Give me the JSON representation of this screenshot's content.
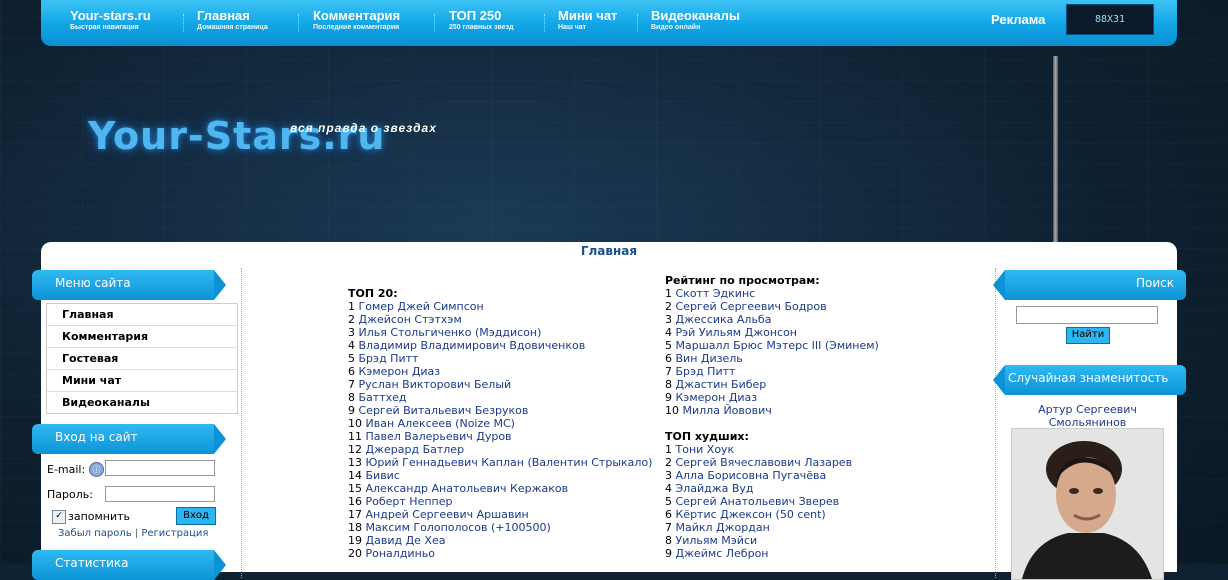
{
  "nav": [
    {
      "title": "Your-stars.ru",
      "sub": "Быстрая навигация"
    },
    {
      "title": "Главная",
      "sub": "Домашняя страница"
    },
    {
      "title": "Комментария",
      "sub": "Последние комментария"
    },
    {
      "title": "ТОП 250",
      "sub": "250 главных звезд"
    },
    {
      "title": "Мини чат",
      "sub": "Наш чат"
    },
    {
      "title": "Видеоканалы",
      "sub": "Видео онлайн"
    }
  ],
  "ads_label": "Реклама",
  "banner_label": "88X31",
  "logo": {
    "main": "Your-Stars.ru",
    "tagline": "вся правда о звездах"
  },
  "breadcrumb": "Главная",
  "site_menu": {
    "title": "Меню сайта",
    "items": [
      "Главная",
      "Комментария",
      "Гостевая",
      "Мини чат",
      "Видеоканалы"
    ]
  },
  "login": {
    "title": "Вход на сайт",
    "email_label": "E-mail:",
    "password_label": "Пароль:",
    "remember_label": "запомнить",
    "submit_label": "Вход",
    "forgot_link": "Забыл пароль",
    "separator": "|",
    "register_link": "Регистрация"
  },
  "stats_title": "Статистика",
  "top20": {
    "heading": "ТОП 20:",
    "items": [
      {
        "n": "1",
        "name": "Гомер Джей Симпсон"
      },
      {
        "n": "2",
        "name": "Джейсон Стэтхэм"
      },
      {
        "n": "3",
        "name": "Илья Стольгиченко (Мэддисон)"
      },
      {
        "n": "4",
        "name": "Владимир Владимирович Вдовиченков"
      },
      {
        "n": "5",
        "name": "Брэд Питт"
      },
      {
        "n": "6",
        "name": "Кэмерон Диаз"
      },
      {
        "n": "7",
        "name": "Руслан Викторович Белый"
      },
      {
        "n": "8",
        "name": "Баттхед"
      },
      {
        "n": "9",
        "name": "Сергей Витальевич Безруков"
      },
      {
        "n": "10",
        "name": "Иван Алексеев (Noize MC)"
      },
      {
        "n": "11",
        "name": "Павел Валерьевич Дуров"
      },
      {
        "n": "12",
        "name": "Джерард Батлер"
      },
      {
        "n": "13",
        "name": "Юрий Геннадьевич Каплан (Валентин Стрыкало)"
      },
      {
        "n": "14",
        "name": "Бивис"
      },
      {
        "n": "15",
        "name": "Александр Анатольевич Кержаков"
      },
      {
        "n": "16",
        "name": "Роберт Неппер"
      },
      {
        "n": "17",
        "name": "Андрей Сергеевич Аршавин"
      },
      {
        "n": "18",
        "name": "Максим Голополосов (+100500)"
      },
      {
        "n": "19",
        "name": "Давид Де Хеа"
      },
      {
        "n": "20",
        "name": "Роналдиньо"
      }
    ]
  },
  "rating_views": {
    "heading": "Рейтинг по просмотрам:",
    "items": [
      {
        "n": "1",
        "name": "Скотт Эдкинс"
      },
      {
        "n": "2",
        "name": "Сергей Сергеевич Бодров"
      },
      {
        "n": "3",
        "name": "Джессика Альба"
      },
      {
        "n": "4",
        "name": "Рэй Уильям Джонсон"
      },
      {
        "n": "5",
        "name": "Маршалл Брюс Мэтерс III (Эминем)"
      },
      {
        "n": "6",
        "name": "Вин Дизель"
      },
      {
        "n": "7",
        "name": "Брэд Питт"
      },
      {
        "n": "8",
        "name": "Джастин Бибер"
      },
      {
        "n": "9",
        "name": "Кэмерон Диаз"
      },
      {
        "n": "10",
        "name": "Милла Йовович"
      }
    ]
  },
  "worst": {
    "heading": "ТОП худших:",
    "items": [
      {
        "n": "1",
        "name": "Тони Хоук"
      },
      {
        "n": "2",
        "name": "Сергей Вячеславович Лазарев"
      },
      {
        "n": "3",
        "name": "Алла Борисовна Пугачёва"
      },
      {
        "n": "4",
        "name": "Элайджа Вуд"
      },
      {
        "n": "5",
        "name": "Сергей Анатольевич Зверев"
      },
      {
        "n": "6",
        "name": "Кёртис Джексон (50 cent)"
      },
      {
        "n": "7",
        "name": "Майкл Джордан"
      },
      {
        "n": "8",
        "name": "Уильям Мэйси"
      },
      {
        "n": "9",
        "name": "Джеймс Леброн"
      }
    ]
  },
  "search": {
    "title": "Поиск",
    "button": "Найти"
  },
  "random_celeb": {
    "title": "Случайная знаменитость",
    "name": "Артур Сергеевич Смольянинов"
  }
}
